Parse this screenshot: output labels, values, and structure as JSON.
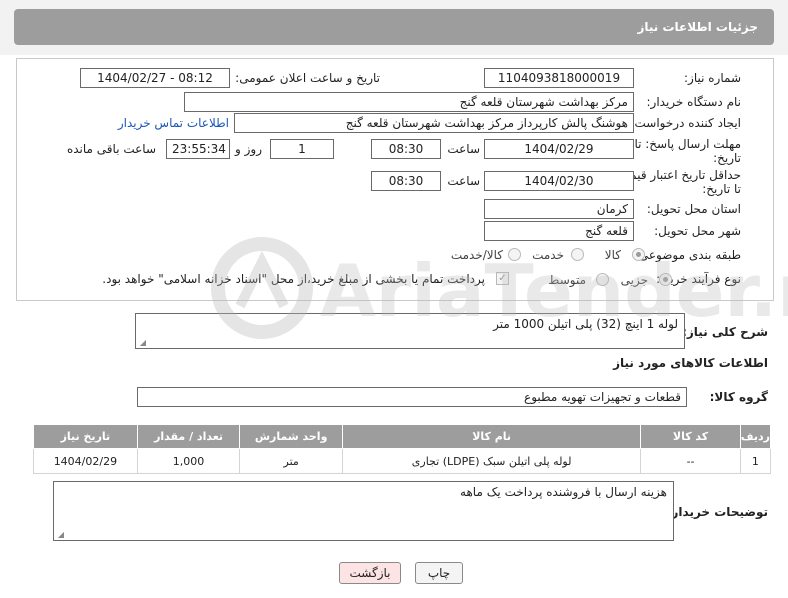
{
  "header": {
    "title": "جزئیات اطلاعات نیاز"
  },
  "form": {
    "need_number": {
      "label": "شماره نیاز:",
      "value": "1104093818000019"
    },
    "announce_datetime": {
      "label": "تاریخ و ساعت اعلان عمومی:",
      "value": "1404/02/27 - 08:12"
    },
    "buyer_org": {
      "label": "نام دستگاه خریدار:",
      "value": "مرکز بهداشت شهرستان قلعه گنج"
    },
    "requester": {
      "label": "ایجاد کننده درخواست:",
      "value": "هوشنگ پالش کارپرداز مرکز بهداشت شهرستان قلعه گنج",
      "contact_link": "اطلاعات تماس خریدار"
    },
    "reply_deadline": {
      "label_line1": "مهلت ارسال پاسخ: تا",
      "label_line2": "تاریخ:",
      "date": "1404/02/29",
      "time_label": "ساعت",
      "time": "08:30",
      "days": "1",
      "days_label": "روز و",
      "remaining": "23:55:34",
      "remaining_label": "ساعت باقی مانده"
    },
    "price_validity": {
      "label_line1": "حداقل تاریخ اعتبار قیمت:",
      "label_line2": "تا تاریخ:",
      "date": "1404/02/30",
      "time_label": "ساعت",
      "time": "08:30"
    },
    "province": {
      "label": "استان محل تحویل:",
      "value": "کرمان"
    },
    "city": {
      "label": "شهر محل تحویل:",
      "value": "قلعه گنج"
    },
    "category": {
      "label": "طبقه بندی موضوعی:",
      "options": [
        "کالا",
        "خدمت",
        "کالا/خدمت"
      ],
      "selected": "کالا"
    },
    "process_type": {
      "label": "نوع فرآیند خرید :",
      "options": [
        "جزیی",
        "متوسط"
      ],
      "selected": "جزیی",
      "payment_note": "پرداخت تمام یا بخشی از مبلغ خرید،از محل \"اسناد خزانه اسلامی\" خواهد بود."
    }
  },
  "summary": {
    "label": "شرح کلی نیاز:",
    "value": "لوله 1 اینچ (32) پلی اتیلن  1000 متر"
  },
  "goods_section": {
    "title": "اطلاعات کالاهای مورد نیاز",
    "group_label": "گروه کالا:",
    "group_value": "قطعات و تجهیزات تهویه مطبوع"
  },
  "table": {
    "columns": [
      "ردیف",
      "کد کالا",
      "نام کالا",
      "واحد شمارش",
      "تعداد / مقدار",
      "تاریخ نیاز"
    ],
    "rows": [
      [
        "1",
        "--",
        "لوله پلی اتیلن سبک (LDPE) تجاری",
        "متر",
        "1,000",
        "1404/02/29"
      ]
    ]
  },
  "buyer_notes": {
    "label": "توضیحات خریدار:",
    "value": "هزینه ارسال با فروشنده پرداخت یک ماهه"
  },
  "buttons": {
    "print": "چاپ",
    "back": "بازگشت"
  },
  "watermark": {
    "text": "AriaTender.neT"
  },
  "colors": {
    "header_bg": "#9d9d9d",
    "link": "#1a57b7",
    "back_button_bg": "#fde4e4"
  }
}
